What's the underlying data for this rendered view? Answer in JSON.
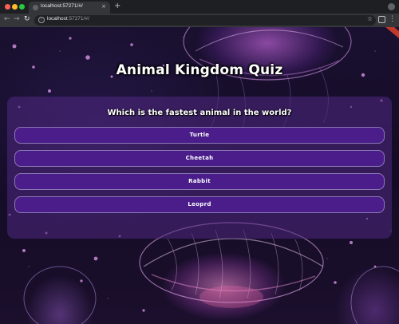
{
  "browser": {
    "tab_title": "localhost:57271/#/",
    "tab_close_glyph": "×",
    "new_tab_glyph": "+",
    "url_host": "localhost",
    "url_rest": ":57271/#/",
    "info_glyph": "i",
    "star_glyph": "☆",
    "menu_glyph": "⋮",
    "back_glyph": "←",
    "forward_glyph": "→",
    "reload_glyph": "↻",
    "icons": [
      "close-icon",
      "plus-icon",
      "back-arrow-icon",
      "forward-arrow-icon",
      "reload-icon",
      "info-icon",
      "bookmark-star-icon",
      "extensions-icon",
      "menu-icon",
      "profile-icon"
    ]
  },
  "quiz": {
    "title": "Animal Kingdom Quiz",
    "question": "Which is the fastest animal in the world?",
    "answers": [
      "Turtle",
      "Cheetah",
      "Rabbit",
      "Leoprd"
    ]
  },
  "colors": {
    "answer_bg": "#4a1d8a",
    "answer_border": "#8a7ab4",
    "card_bg": "rgba(80,40,130,0.55)",
    "debug_ribbon": "#c0392b"
  }
}
